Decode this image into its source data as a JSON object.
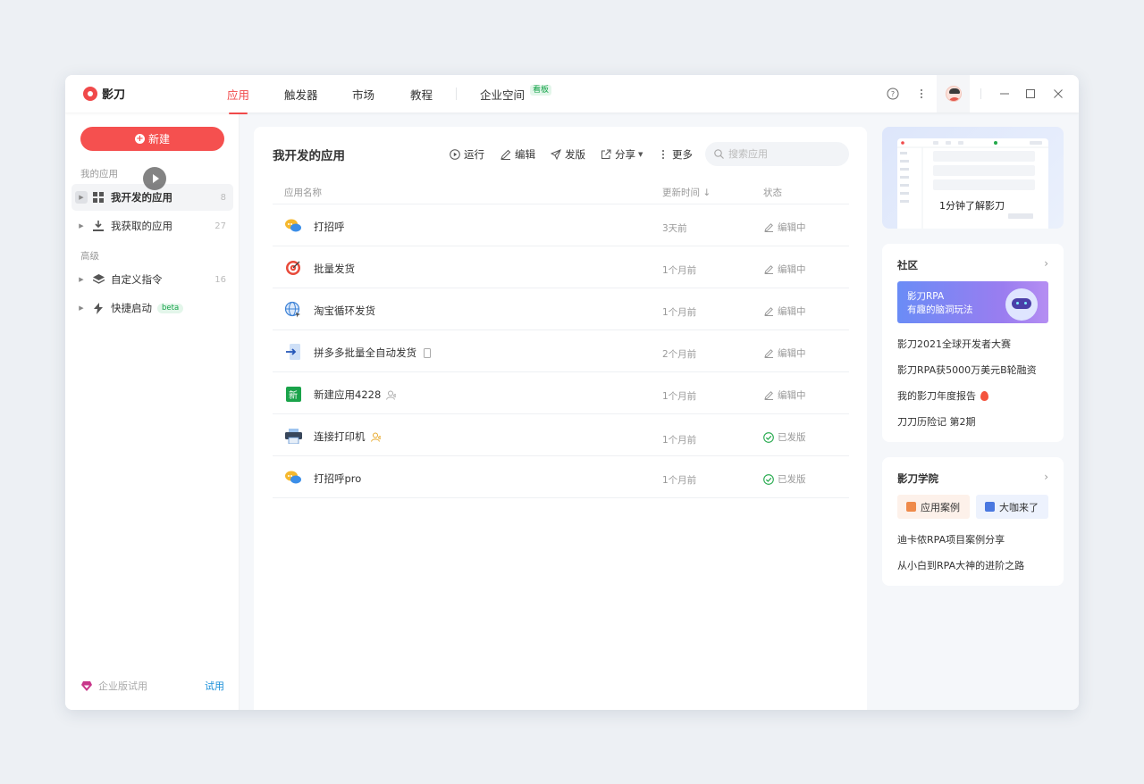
{
  "app": {
    "name": "影刀"
  },
  "nav": {
    "tabs": [
      "应用",
      "触发器",
      "市场",
      "教程",
      "企业空间"
    ],
    "active_index": 0,
    "enterprise_badge": "看板"
  },
  "sidebar": {
    "new_button": "新建",
    "section_my": "我的应用",
    "section_advanced": "高级",
    "items": [
      {
        "label": "我开发的应用",
        "count": "8"
      },
      {
        "label": "我获取的应用",
        "count": "27"
      },
      {
        "label": "自定义指令",
        "count": "16"
      },
      {
        "label": "快捷启动",
        "badge": "beta"
      }
    ],
    "trial_label": "企业版试用",
    "trial_link": "试用"
  },
  "main": {
    "title": "我开发的应用",
    "toolbar": {
      "run": "运行",
      "edit": "编辑",
      "publish": "发版",
      "share": "分享",
      "more": "更多"
    },
    "search_placeholder": "搜索应用",
    "columns": {
      "name": "应用名称",
      "updated": "更新时间 ↓",
      "status": "状态"
    },
    "rows": [
      {
        "name": "打招呼",
        "time": "3天前",
        "status": "编辑中",
        "icon": "chat-bubbles-icon"
      },
      {
        "name": "批量发货",
        "time": "1个月前",
        "status": "编辑中",
        "icon": "target-icon"
      },
      {
        "name": "淘宝循环发货",
        "time": "1个月前",
        "status": "编辑中",
        "icon": "globe-icon"
      },
      {
        "name": "拼多多批量全自动发货",
        "time": "2个月前",
        "status": "编辑中",
        "icon": "import-icon",
        "tag": "mobile-icon"
      },
      {
        "name": "新建应用4228",
        "time": "1个月前",
        "status": "编辑中",
        "icon": "new-badge-icon",
        "icon_text": "新",
        "tag": "shared-user-icon"
      },
      {
        "name": "连接打印机",
        "time": "1个月前",
        "status": "已发版",
        "icon": "printer-icon",
        "tag": "shared-user-icon"
      },
      {
        "name": "打招呼pro",
        "time": "1个月前",
        "status": "已发版",
        "icon": "chat-bubbles-icon"
      }
    ]
  },
  "right": {
    "video_caption": "1分钟了解影刀",
    "community": {
      "title": "社区",
      "banner_line1": "影刀RPA",
      "banner_line2": "有趣的脑洞玩法",
      "links": [
        "影刀2021全球开发者大赛",
        "影刀RPA获5000万美元B轮融资",
        "我的影刀年度报告",
        "刀刀历险记 第2期"
      ]
    },
    "academy": {
      "title": "影刀学院",
      "chips": [
        "应用案例",
        "大咖来了"
      ],
      "links": [
        "迪卡侬RPA项目案例分享",
        "从小白到RPA大神的进阶之路"
      ]
    }
  },
  "colors": {
    "accent": "#f0494a",
    "published": "#22a84a",
    "link": "#1a8fd8"
  }
}
